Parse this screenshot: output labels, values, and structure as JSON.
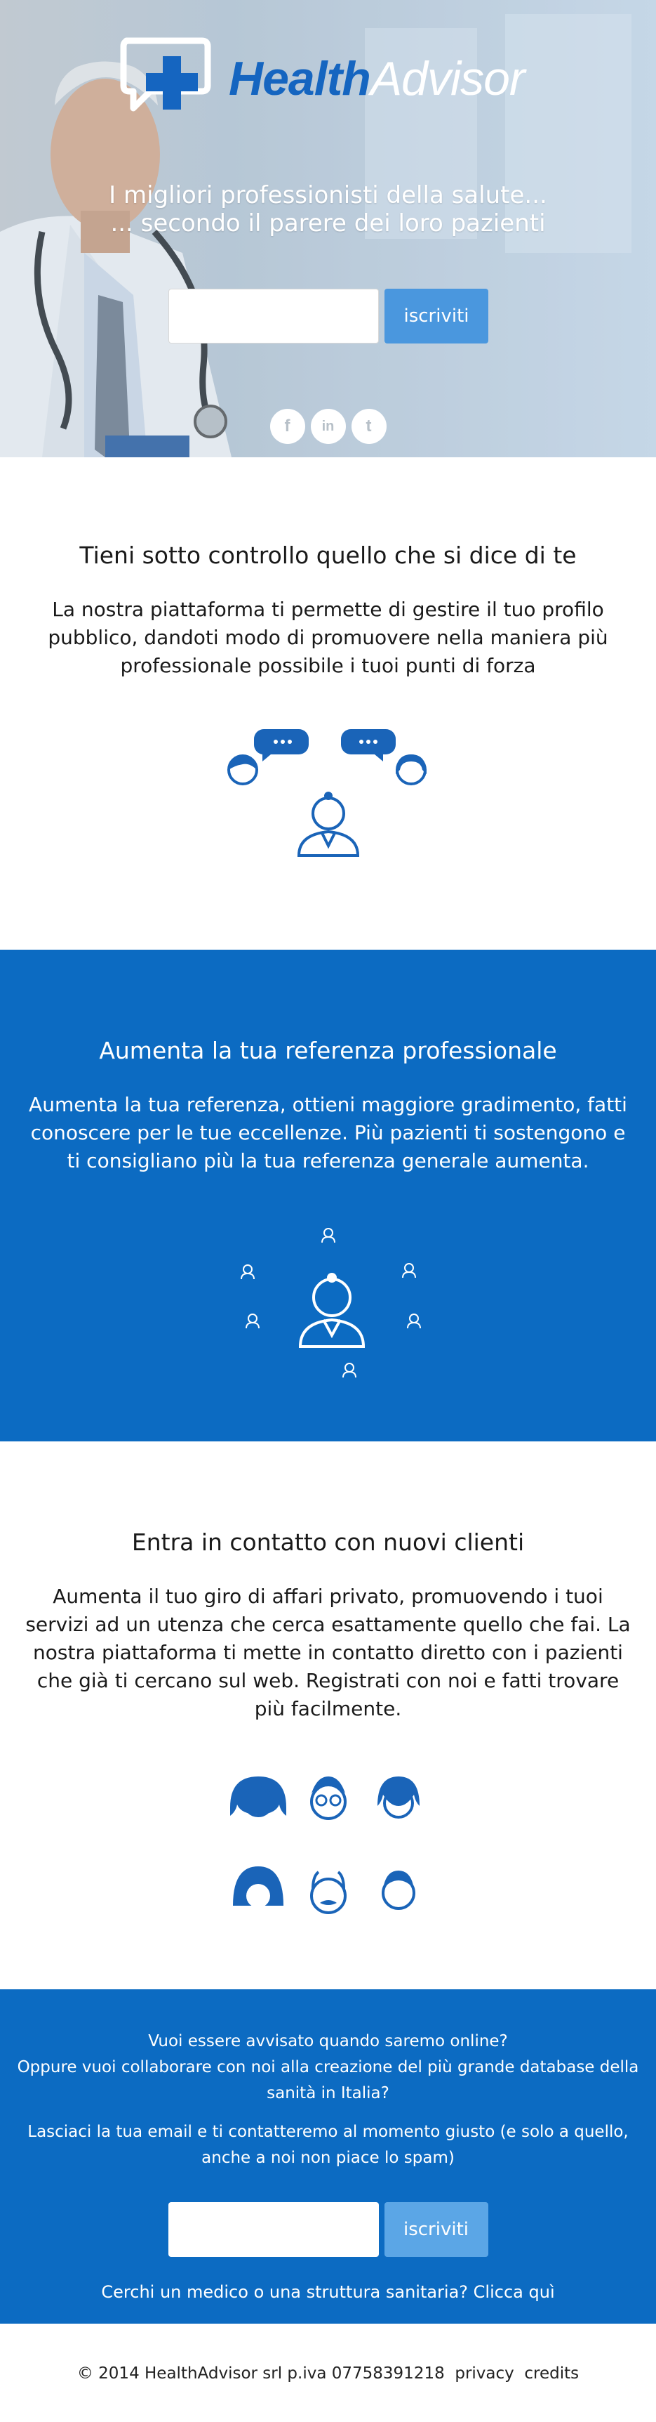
{
  "hero": {
    "logo_health": "Health",
    "logo_advisor": "Advisor",
    "line1": "I migliori professionisti della salute...",
    "line2": "... secondo il parere dei loro pazienti",
    "email_placeholder": "",
    "subscribe_label": "iscriviti",
    "social": [
      {
        "name": "facebook-icon",
        "glyph": "f"
      },
      {
        "name": "linkedin-icon",
        "glyph": "in"
      },
      {
        "name": "twitter-icon",
        "glyph": "t"
      }
    ]
  },
  "section1": {
    "title": "Tieni sotto controllo quello che si dice di te",
    "text": "La nostra piattaforma ti permette di gestire il tuo profilo pubblico, dandoti modo di promuovere nella maniera più professionale possibile i tuoi punti di forza"
  },
  "section2": {
    "title": "Aumenta la tua referenza professionale",
    "text": "Aumenta la tua referenza, ottieni maggiore gradimento, fatti conoscere per le tue eccellenze. Più pazienti ti sostengono e ti consigliano più la tua referenza generale aumenta."
  },
  "section3": {
    "title": "Entra in contatto con nuovi clienti",
    "text": "Aumenta il tuo giro di affari privato, promuovendo i tuoi servizi ad un utenza che cerca esattamente quello che fai. La nostra piattaforma ti mette in contatto diretto con i pazienti che già ti cercano sul web. Registrati con noi e fatti trovare più facilmente."
  },
  "section4": {
    "line1": "Vuoi essere avvisato quando saremo online?",
    "line2": "Oppure vuoi collaborare con noi alla creazione del più grande database della sanità in Italia?",
    "line3": "Lasciaci la tua email e ti contatteremo al momento giusto (e solo a quello, anche a noi non piace lo spam)",
    "email_placeholder": "",
    "subscribe_label": "iscriviti",
    "link": "Cerchi un medico o una struttura sanitaria? Clicca quì"
  },
  "footer": {
    "copyright": "© 2014 HealthAdvisor srl p.iva 07758391218",
    "privacy": "privacy",
    "credits": "credits"
  },
  "colors": {
    "brand_blue": "#0c6bc2",
    "button_blue": "#4a97de",
    "icon_blue": "#1a64b8"
  }
}
